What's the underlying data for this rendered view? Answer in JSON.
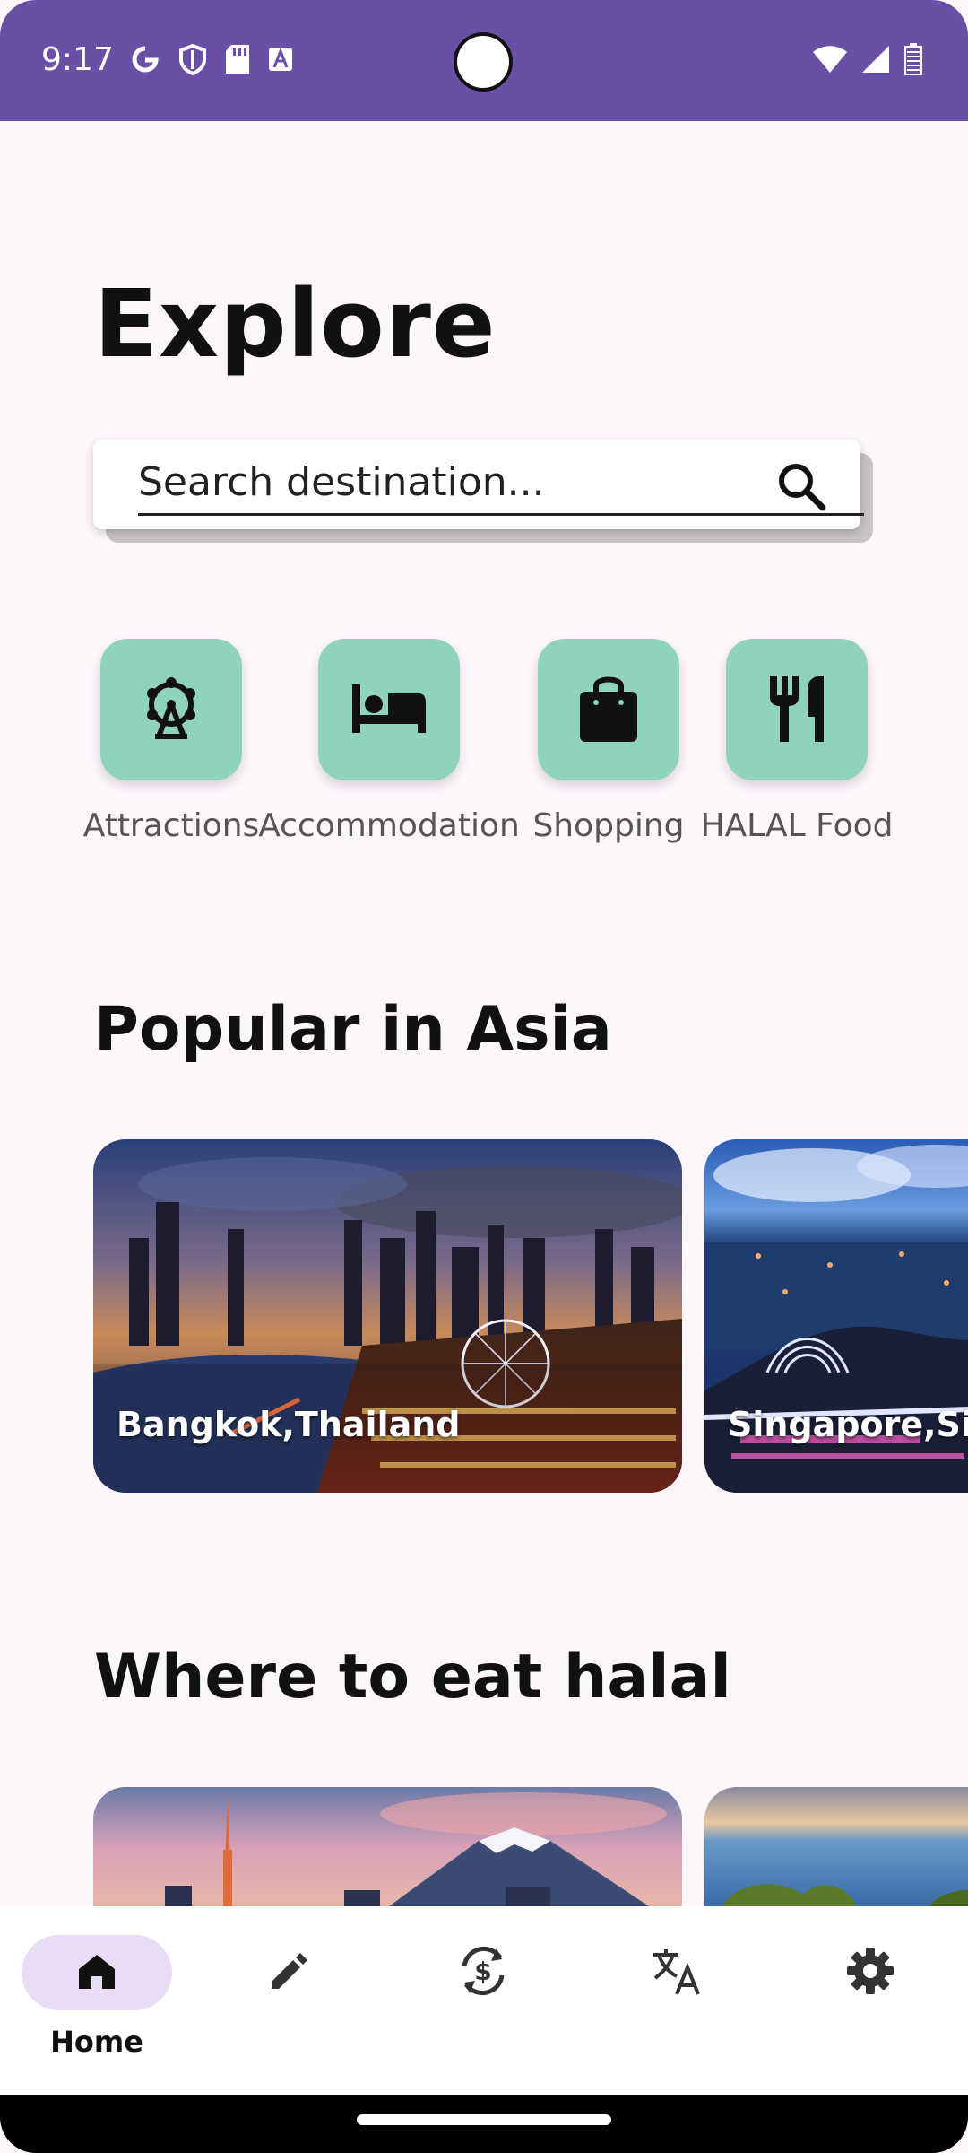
{
  "status_bar": {
    "time": "9:17",
    "left_icons": [
      "google-g-icon",
      "shield-icon",
      "sd-card-icon",
      "text-a-icon"
    ],
    "right_icons": [
      "wifi-icon",
      "signal-icon",
      "battery-icon"
    ],
    "background_color": "#6a4fa6"
  },
  "header": {
    "title": "Explore"
  },
  "search": {
    "placeholder": "Search destination..."
  },
  "categories": [
    {
      "label": "Attractions",
      "icon": "ferris-wheel-icon"
    },
    {
      "label": "Accommodation",
      "icon": "bed-icon"
    },
    {
      "label": "Shopping",
      "icon": "shopping-bag-icon"
    },
    {
      "label": "HALAL Food",
      "icon": "fork-knife-icon"
    }
  ],
  "sections": {
    "popular": {
      "title": "Popular in Asia",
      "cards": [
        {
          "label": "Bangkok,Thailand"
        },
        {
          "label": "Singapore,Singapore"
        }
      ]
    },
    "halal": {
      "title": "Where to eat halal",
      "cards": [
        {
          "label": ""
        },
        {
          "label": ""
        }
      ]
    }
  },
  "bottom_nav": {
    "items": [
      {
        "label": "Home",
        "icon": "home-icon",
        "active": true
      },
      {
        "label": "",
        "icon": "pencil-icon",
        "active": false
      },
      {
        "label": "",
        "icon": "currency-exchange-icon",
        "active": false
      },
      {
        "label": "",
        "icon": "translate-icon",
        "active": false
      },
      {
        "label": "",
        "icon": "gear-icon",
        "active": false
      }
    ]
  },
  "colors": {
    "accent": "#6a4fa6",
    "category_tile": "#8fd3bd",
    "nav_active_pill": "#e9ddf6",
    "background": "#fdf6fb"
  }
}
